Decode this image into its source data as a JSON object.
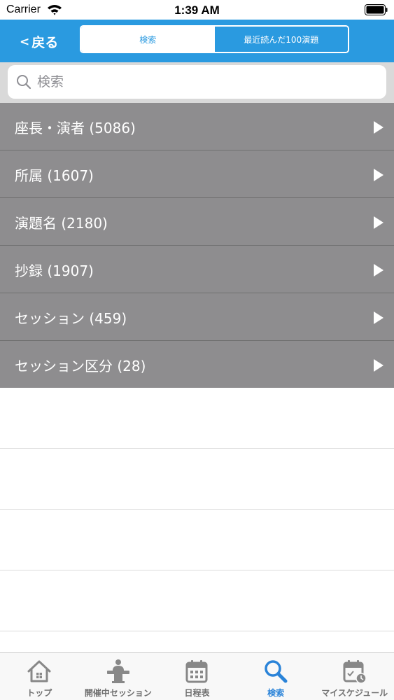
{
  "status_bar": {
    "carrier": "Carrier",
    "time": "1:39 AM"
  },
  "nav": {
    "back_label": "戻る",
    "back_chevron": "<",
    "segments": [
      {
        "label": "検索",
        "selected": true
      },
      {
        "label": "最近読んだ100演題",
        "selected": false
      }
    ]
  },
  "search": {
    "placeholder": "検索",
    "value": ""
  },
  "categories": [
    {
      "label": "座長・演者 (5086)"
    },
    {
      "label": "所属 (1607)"
    },
    {
      "label": "演題名 (2180)"
    },
    {
      "label": "抄録 (1907)"
    },
    {
      "label": "セッション (459)"
    },
    {
      "label": "セッション区分 (28)"
    }
  ],
  "tabs": [
    {
      "label": "トップ",
      "icon": "home-icon",
      "active": false
    },
    {
      "label": "開催中セッション",
      "icon": "presenter-icon",
      "active": false
    },
    {
      "label": "日程表",
      "icon": "calendar-icon",
      "active": false
    },
    {
      "label": "検索",
      "icon": "search-icon",
      "active": true
    },
    {
      "label": "マイスケジュール",
      "icon": "calendar-check-icon",
      "active": false
    }
  ],
  "colors": {
    "nav_blue": "#2a9ae0",
    "row_gray": "#8e8d8f",
    "tab_active": "#2a83d8",
    "tab_inactive": "#707070"
  }
}
